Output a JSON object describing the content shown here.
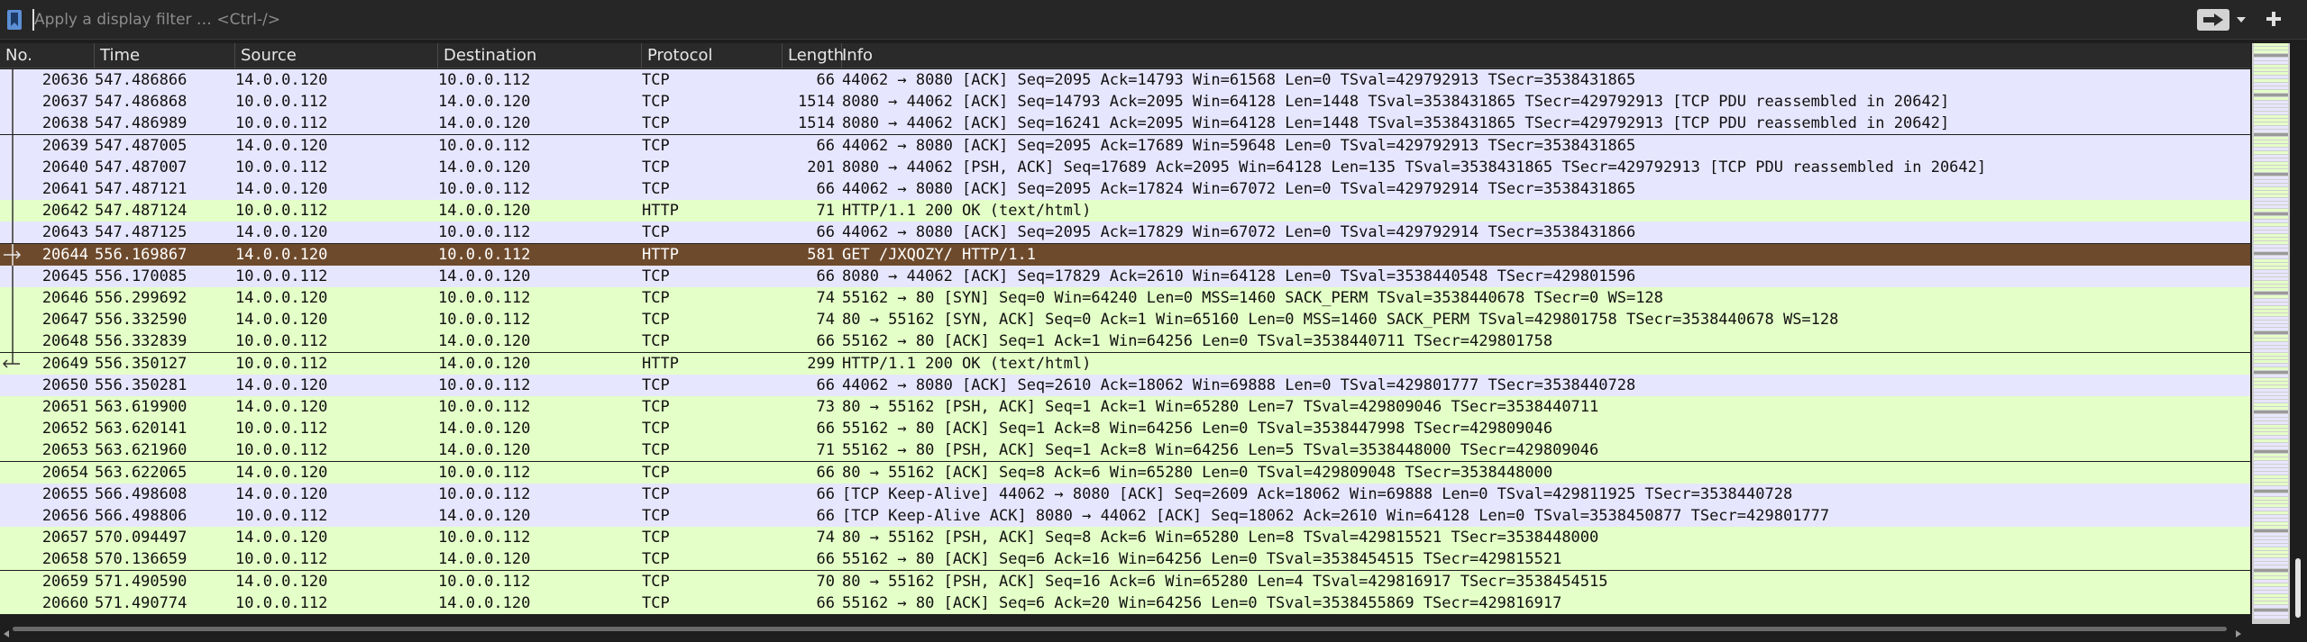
{
  "filter": {
    "placeholder": "Apply a display filter … <Ctrl-/>",
    "value": ""
  },
  "icons": {
    "bookmark": "bookmark-icon",
    "apply": "arrow-right-icon",
    "dropdown": "chevron-down-icon",
    "add": "plus-icon"
  },
  "columns": [
    {
      "key": "no",
      "label": "No."
    },
    {
      "key": "time",
      "label": "Time"
    },
    {
      "key": "source",
      "label": "Source"
    },
    {
      "key": "destination",
      "label": "Destination"
    },
    {
      "key": "protocol",
      "label": "Protocol"
    },
    {
      "key": "length",
      "label": "Length"
    },
    {
      "key": "info",
      "label": "Info"
    }
  ],
  "colors": {
    "tcp": "#e7e6ff",
    "http": "#e4ffc7",
    "selected": "#6e4a2c",
    "selected_text": "#ffffff"
  },
  "packets": [
    {
      "no": "20636",
      "time": "547.486866",
      "source": "14.0.0.120",
      "destination": "10.0.0.112",
      "protocol": "TCP",
      "length": "66",
      "info": "44062 → 8080 [ACK] Seq=2095 Ack=14793 Win=61568 Len=0 TSval=429792913 TSecr=3538431865",
      "cls": "tcp",
      "rel": "line"
    },
    {
      "no": "20637",
      "time": "547.486868",
      "source": "10.0.0.112",
      "destination": "14.0.0.120",
      "protocol": "TCP",
      "length": "1514",
      "info": "8080 → 44062 [ACK] Seq=14793 Ack=2095 Win=64128 Len=1448 TSval=3538431865 TSecr=429792913 [TCP PDU reassembled in 20642]",
      "cls": "tcp",
      "rel": "line"
    },
    {
      "no": "20638",
      "time": "547.486989",
      "source": "10.0.0.112",
      "destination": "14.0.0.120",
      "protocol": "TCP",
      "length": "1514",
      "info": "8080 → 44062 [ACK] Seq=16241 Ack=2095 Win=64128 Len=1448 TSval=3538431865 TSecr=429792913 [TCP PDU reassembled in 20642]",
      "cls": "tcp",
      "rel": "line"
    },
    {
      "no": "20639",
      "time": "547.487005",
      "source": "14.0.0.120",
      "destination": "10.0.0.112",
      "protocol": "TCP",
      "length": "66",
      "info": "44062 → 8080 [ACK] Seq=2095 Ack=17689 Win=59648 Len=0 TSval=429792913 TSecr=3538431865",
      "cls": "tcp",
      "rel": "line"
    },
    {
      "no": "20640",
      "time": "547.487007",
      "source": "10.0.0.112",
      "destination": "14.0.0.120",
      "protocol": "TCP",
      "length": "201",
      "info": "8080 → 44062 [PSH, ACK] Seq=17689 Ack=2095 Win=64128 Len=135 TSval=3538431865 TSecr=429792913 [TCP PDU reassembled in 20642]",
      "cls": "tcp",
      "rel": "line"
    },
    {
      "no": "20641",
      "time": "547.487121",
      "source": "14.0.0.120",
      "destination": "10.0.0.112",
      "protocol": "TCP",
      "length": "66",
      "info": "44062 → 8080 [ACK] Seq=2095 Ack=17824 Win=67072 Len=0 TSval=429792914 TSecr=3538431865",
      "cls": "tcp",
      "rel": "line"
    },
    {
      "no": "20642",
      "time": "547.487124",
      "source": "10.0.0.112",
      "destination": "14.0.0.120",
      "protocol": "HTTP",
      "length": "71",
      "info": "HTTP/1.1 200 OK  (text/html)",
      "cls": "http",
      "rel": "line"
    },
    {
      "no": "20643",
      "time": "547.487125",
      "source": "14.0.0.120",
      "destination": "10.0.0.112",
      "protocol": "TCP",
      "length": "66",
      "info": "44062 → 8080 [ACK] Seq=2095 Ack=17829 Win=67072 Len=0 TSval=429792914 TSecr=3538431866",
      "cls": "tcp",
      "rel": "line"
    },
    {
      "no": "20644",
      "time": "556.169867",
      "source": "14.0.0.120",
      "destination": "10.0.0.112",
      "protocol": "HTTP",
      "length": "581",
      "info": "GET /JXQOZY/ HTTP/1.1",
      "cls": "selected",
      "rel": "request"
    },
    {
      "no": "20645",
      "time": "556.170085",
      "source": "10.0.0.112",
      "destination": "14.0.0.120",
      "protocol": "TCP",
      "length": "66",
      "info": "8080 → 44062 [ACK] Seq=17829 Ack=2610 Win=64128 Len=0 TSval=3538440548 TSecr=429801596",
      "cls": "tcp",
      "rel": "line"
    },
    {
      "no": "20646",
      "time": "556.299692",
      "source": "14.0.0.120",
      "destination": "10.0.0.112",
      "protocol": "TCP",
      "length": "74",
      "info": "55162 → 80 [SYN] Seq=0 Win=64240 Len=0 MSS=1460 SACK_PERM TSval=3538440678 TSecr=0 WS=128",
      "cls": "http",
      "rel": "line"
    },
    {
      "no": "20647",
      "time": "556.332590",
      "source": "14.0.0.120",
      "destination": "10.0.0.112",
      "protocol": "TCP",
      "length": "74",
      "info": "80 → 55162 [SYN, ACK] Seq=0 Ack=1 Win=65160 Len=0 MSS=1460 SACK_PERM TSval=429801758 TSecr=3538440678 WS=128",
      "cls": "http",
      "rel": "line"
    },
    {
      "no": "20648",
      "time": "556.332839",
      "source": "10.0.0.112",
      "destination": "14.0.0.120",
      "protocol": "TCP",
      "length": "66",
      "info": "55162 → 80 [ACK] Seq=1 Ack=1 Win=64256 Len=0 TSval=3538440711 TSecr=429801758",
      "cls": "http",
      "rel": "line"
    },
    {
      "no": "20649",
      "time": "556.350127",
      "source": "10.0.0.112",
      "destination": "14.0.0.120",
      "protocol": "HTTP",
      "length": "299",
      "info": "HTTP/1.1 200 OK  (text/html)",
      "cls": "http",
      "rel": "response"
    },
    {
      "no": "20650",
      "time": "556.350281",
      "source": "14.0.0.120",
      "destination": "10.0.0.112",
      "protocol": "TCP",
      "length": "66",
      "info": "44062 → 8080 [ACK] Seq=2610 Ack=18062 Win=69888 Len=0 TSval=429801777 TSecr=3538440728",
      "cls": "tcp",
      "rel": "none"
    },
    {
      "no": "20651",
      "time": "563.619900",
      "source": "14.0.0.120",
      "destination": "10.0.0.112",
      "protocol": "TCP",
      "length": "73",
      "info": "80 → 55162 [PSH, ACK] Seq=1 Ack=1 Win=65280 Len=7 TSval=429809046 TSecr=3538440711",
      "cls": "http",
      "rel": "none"
    },
    {
      "no": "20652",
      "time": "563.620141",
      "source": "10.0.0.112",
      "destination": "14.0.0.120",
      "protocol": "TCP",
      "length": "66",
      "info": "55162 → 80 [ACK] Seq=1 Ack=8 Win=64256 Len=0 TSval=3538447998 TSecr=429809046",
      "cls": "http",
      "rel": "none"
    },
    {
      "no": "20653",
      "time": "563.621960",
      "source": "10.0.0.112",
      "destination": "14.0.0.120",
      "protocol": "TCP",
      "length": "71",
      "info": "55162 → 80 [PSH, ACK] Seq=1 Ack=8 Win=64256 Len=5 TSval=3538448000 TSecr=429809046",
      "cls": "http",
      "rel": "none"
    },
    {
      "no": "20654",
      "time": "563.622065",
      "source": "14.0.0.120",
      "destination": "10.0.0.112",
      "protocol": "TCP",
      "length": "66",
      "info": "80 → 55162 [ACK] Seq=8 Ack=6 Win=65280 Len=0 TSval=429809048 TSecr=3538448000",
      "cls": "http",
      "rel": "none"
    },
    {
      "no": "20655",
      "time": "566.498608",
      "source": "14.0.0.120",
      "destination": "10.0.0.112",
      "protocol": "TCP",
      "length": "66",
      "info": "[TCP Keep-Alive] 44062 → 8080 [ACK] Seq=2609 Ack=18062 Win=69888 Len=0 TSval=429811925 TSecr=3538440728",
      "cls": "tcp",
      "rel": "none"
    },
    {
      "no": "20656",
      "time": "566.498806",
      "source": "10.0.0.112",
      "destination": "14.0.0.120",
      "protocol": "TCP",
      "length": "66",
      "info": "[TCP Keep-Alive ACK] 8080 → 44062 [ACK] Seq=18062 Ack=2610 Win=64128 Len=0 TSval=3538450877 TSecr=429801777",
      "cls": "tcp",
      "rel": "none"
    },
    {
      "no": "20657",
      "time": "570.094497",
      "source": "14.0.0.120",
      "destination": "10.0.0.112",
      "protocol": "TCP",
      "length": "74",
      "info": "80 → 55162 [PSH, ACK] Seq=8 Ack=6 Win=65280 Len=8 TSval=429815521 TSecr=3538448000",
      "cls": "http",
      "rel": "none"
    },
    {
      "no": "20658",
      "time": "570.136659",
      "source": "10.0.0.112",
      "destination": "14.0.0.120",
      "protocol": "TCP",
      "length": "66",
      "info": "55162 → 80 [ACK] Seq=6 Ack=16 Win=64256 Len=0 TSval=3538454515 TSecr=429815521",
      "cls": "http",
      "rel": "none"
    },
    {
      "no": "20659",
      "time": "571.490590",
      "source": "14.0.0.120",
      "destination": "10.0.0.112",
      "protocol": "TCP",
      "length": "70",
      "info": "80 → 55162 [PSH, ACK] Seq=16 Ack=6 Win=65280 Len=4 TSval=429816917 TSecr=3538454515",
      "cls": "http",
      "rel": "none"
    },
    {
      "no": "20660",
      "time": "571.490774",
      "source": "10.0.0.112",
      "destination": "14.0.0.120",
      "protocol": "TCP",
      "length": "66",
      "info": "55162 → 80 [ACK] Seq=6 Ack=20 Win=64256 Len=0 TSval=3538455869 TSecr=429816917",
      "cls": "http",
      "rel": "none"
    }
  ]
}
